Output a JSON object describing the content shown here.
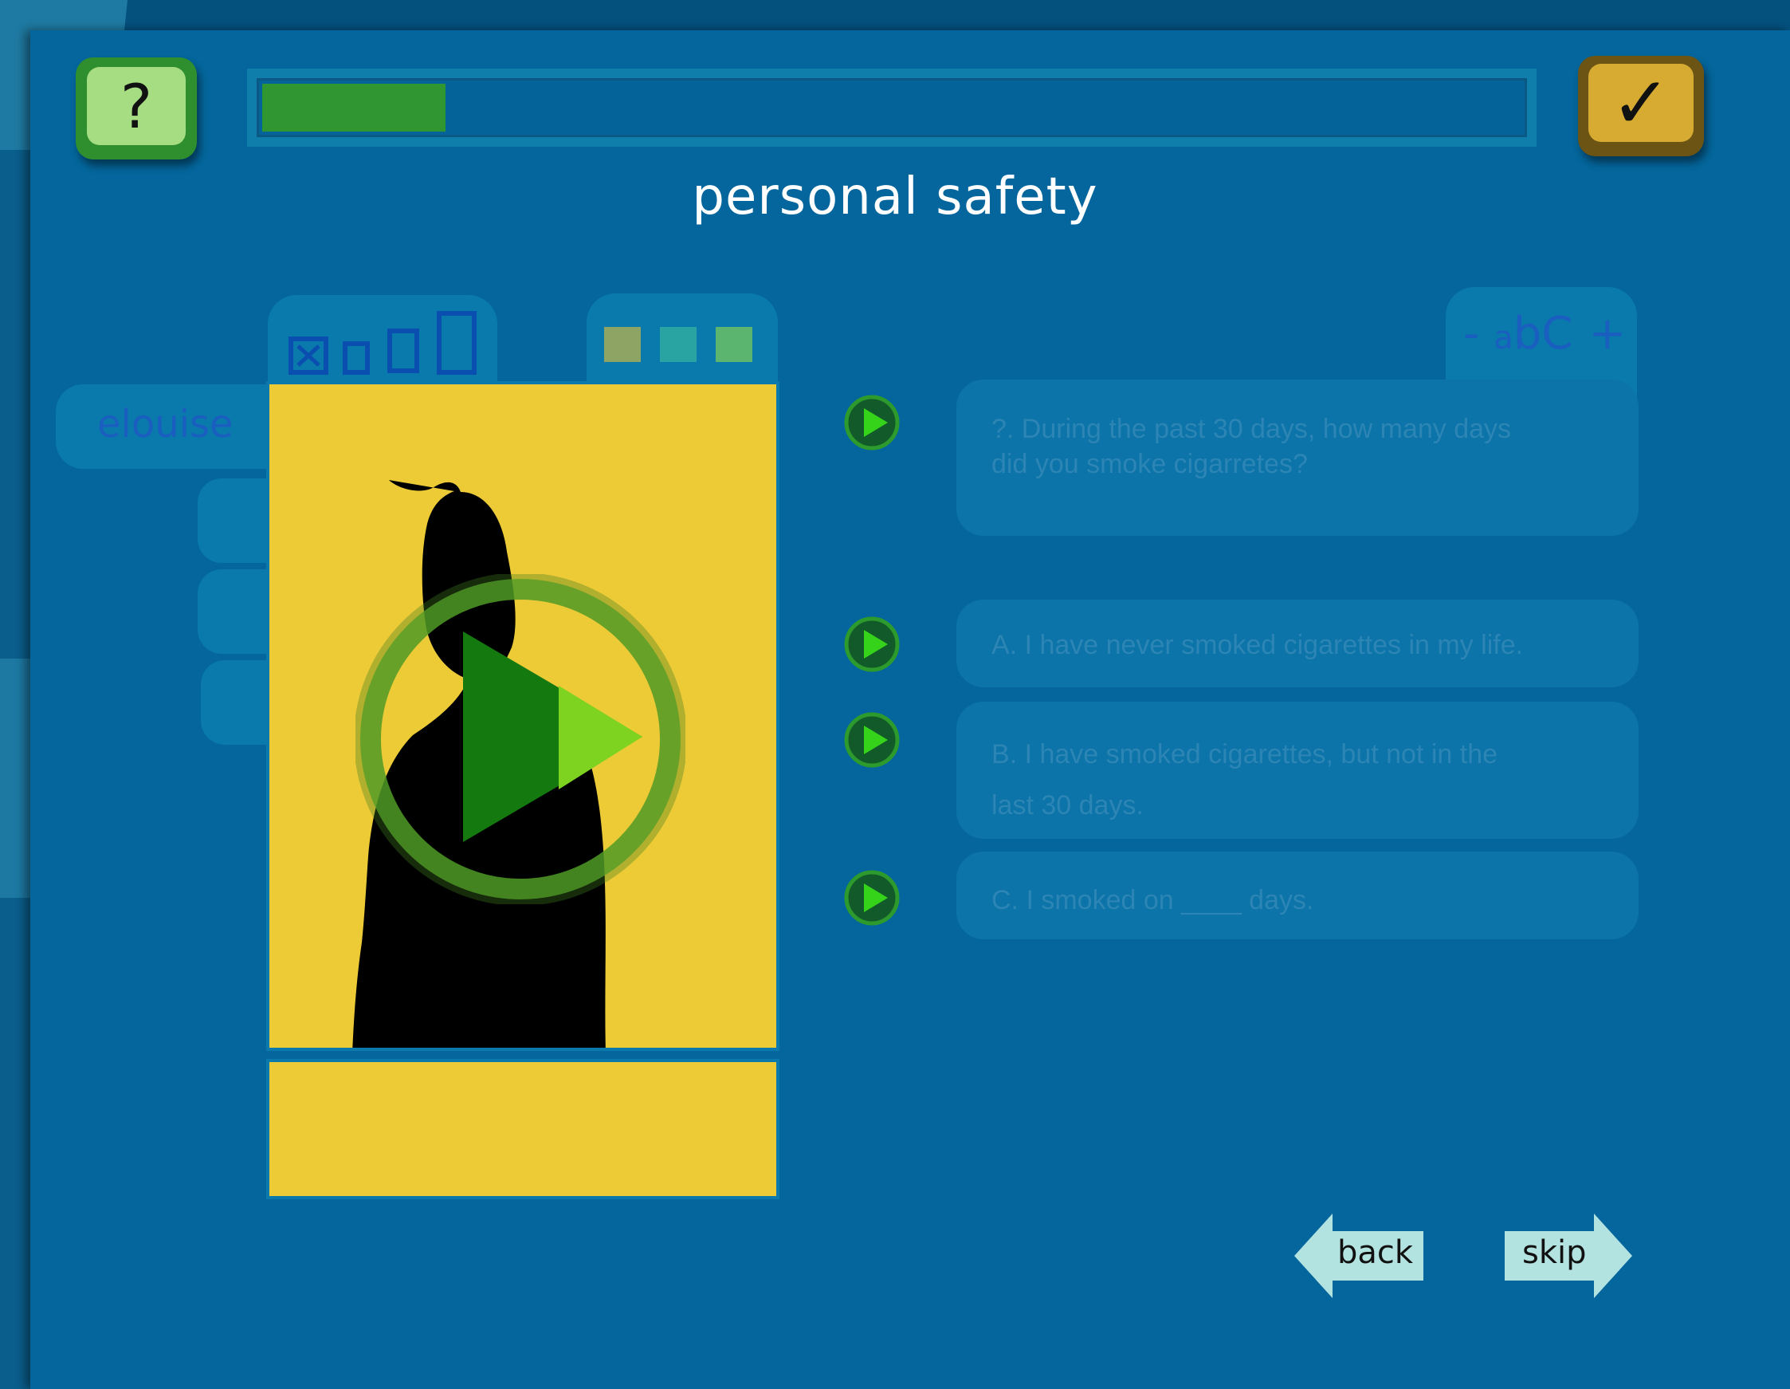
{
  "header": {
    "help_label": "?",
    "done_label": "✓",
    "progress_fraction": 0.145,
    "title": "personal safety"
  },
  "display_controls": {
    "text_size_options": [
      "extra-small",
      "small",
      "medium",
      "large"
    ],
    "color_swatches": [
      "#8ea465",
      "#2aa3a3",
      "#5cb56f"
    ],
    "font_size": {
      "decrease_label": "-",
      "sample_small": "a",
      "sample_large": "bC",
      "increase_label": "+"
    }
  },
  "profile": {
    "name": "elouise"
  },
  "question": {
    "text_line1": "?. During the past 30 days, how many days",
    "text_line2": "did you smoke cigarretes?"
  },
  "answers": [
    {
      "label": "A. I have never smoked cigarettes in my life."
    },
    {
      "label_line1": "B. I have smoked cigarettes, but not in the",
      "label_line2": "last 30 days."
    },
    {
      "label": "C. I smoked on ____ days."
    }
  ],
  "navigation": {
    "back_label": "back",
    "skip_label": "skip"
  },
  "colors": {
    "background": "#04669c",
    "portrait_background": "#edcb37",
    "progress_fill": "#2f9632",
    "help_button": "#a6dd83",
    "done_button": "#d7ab32",
    "nav_button": "#b3e3e0"
  }
}
